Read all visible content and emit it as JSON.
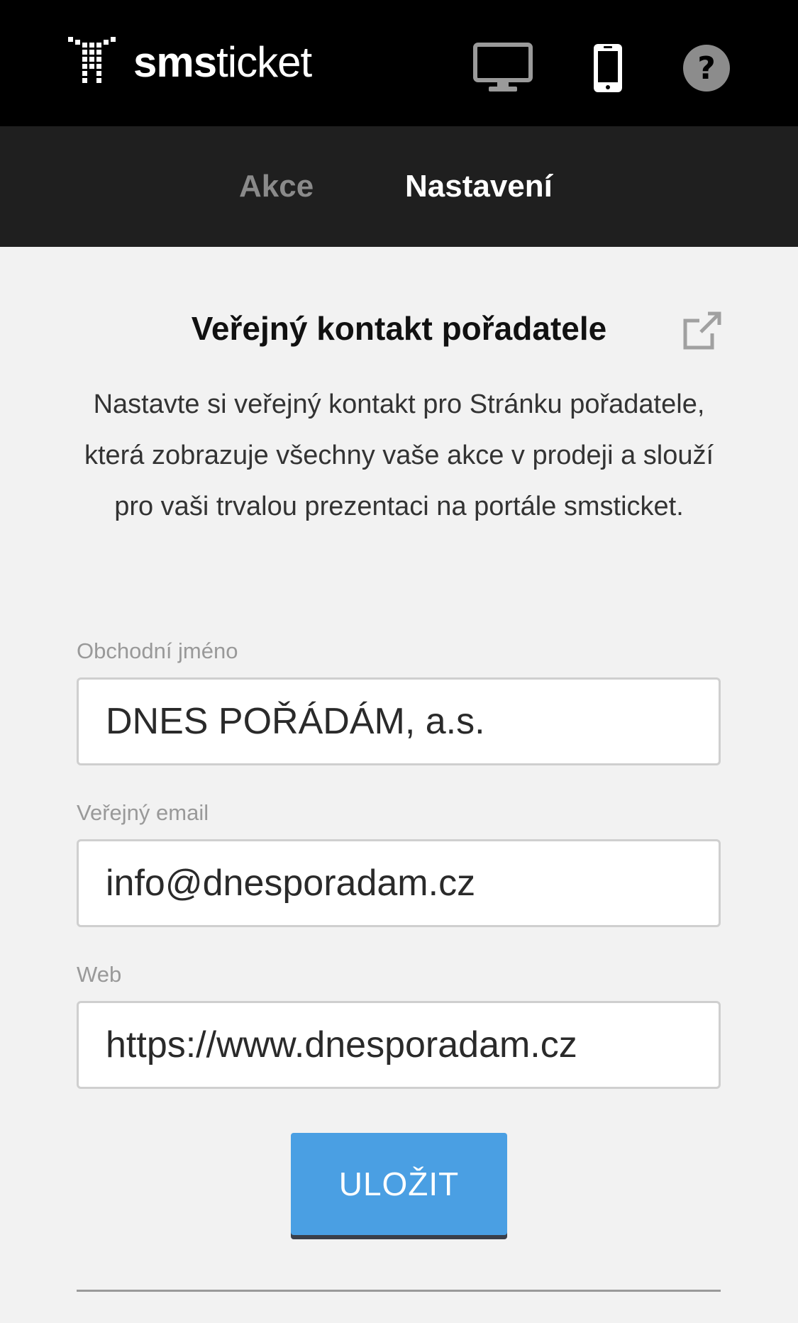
{
  "header": {
    "logo_bold": "sms",
    "logo_regular": "ticket",
    "icons": {
      "desktop": "desktop-icon",
      "mobile": "mobile-icon",
      "help": "help-icon"
    }
  },
  "nav": {
    "tabs": [
      {
        "label": "Akce",
        "active": false
      },
      {
        "label": "Nastavení",
        "active": true
      }
    ]
  },
  "section": {
    "title": "Veřejný kontakt pořadatele",
    "description": "Nastavte si veřejný kontakt pro Stránku pořadatele, která zobrazuje všechny vaše akce v prodeji a slouží pro vaši trvalou prezentaci na portále smsticket."
  },
  "form": {
    "business_name": {
      "label": "Obchodní jméno",
      "value": "DNES POŘÁDÁM, a.s."
    },
    "public_email": {
      "label": "Veřejný email",
      "value": "info@dnesporadam.cz"
    },
    "web": {
      "label": "Web",
      "value": "https://www.dnesporadam.cz"
    },
    "save_label": "ULOŽIT"
  },
  "colors": {
    "header_bg": "#000000",
    "nav_bg": "#1f1f1f",
    "page_bg": "#f2f2f2",
    "button_bg": "#4a9fe3",
    "inactive_tab": "#8a8a8a"
  }
}
